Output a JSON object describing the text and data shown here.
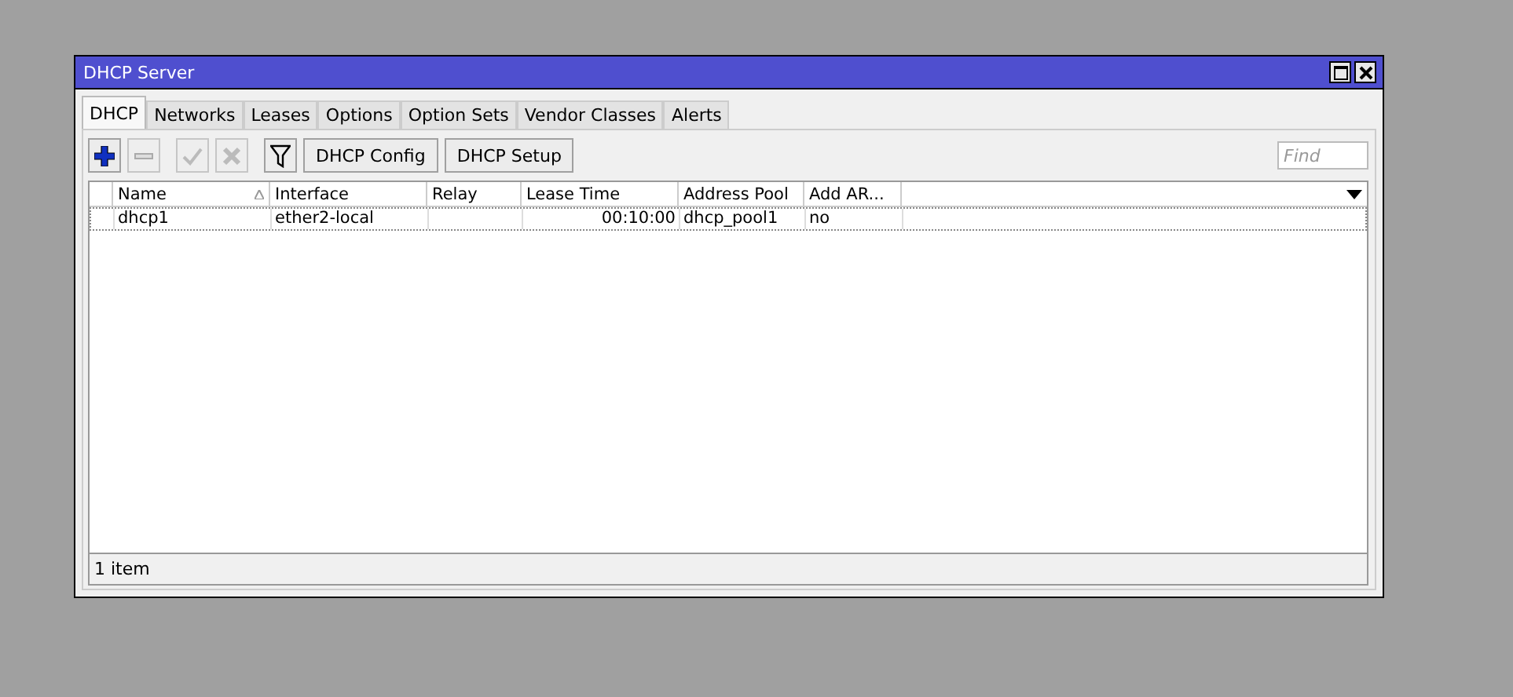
{
  "window": {
    "title": "DHCP Server"
  },
  "tabs": [
    {
      "label": "DHCP",
      "selected": true
    },
    {
      "label": "Networks",
      "selected": false
    },
    {
      "label": "Leases",
      "selected": false
    },
    {
      "label": "Options",
      "selected": false
    },
    {
      "label": "Option Sets",
      "selected": false
    },
    {
      "label": "Vendor Classes",
      "selected": false
    },
    {
      "label": "Alerts",
      "selected": false
    }
  ],
  "toolbar": [
    {
      "kind": "add",
      "disabled": false
    },
    {
      "kind": "remove",
      "disabled": true
    },
    {
      "kind": "enable",
      "disabled": true
    },
    {
      "kind": "disable",
      "disabled": true
    },
    {
      "kind": "filter",
      "disabled": false
    },
    {
      "kind": "text",
      "label": "DHCP Config",
      "disabled": false
    },
    {
      "kind": "text",
      "label": "DHCP Setup",
      "disabled": false
    }
  ],
  "search": {
    "placeholder": "Find"
  },
  "table": {
    "columns": [
      {
        "label": "Name",
        "sorted": true
      },
      {
        "label": "Interface",
        "sorted": false
      },
      {
        "label": "Relay",
        "sorted": false
      },
      {
        "label": "Lease Time",
        "sorted": false
      },
      {
        "label": "Address Pool",
        "sorted": false
      },
      {
        "label": "Add AR...",
        "sorted": false
      }
    ],
    "rows": [
      {
        "selected": false,
        "cells": [
          "dhcp1",
          "ether2-local",
          "",
          "00:10:00",
          "dhcp_pool1",
          "no"
        ]
      }
    ]
  },
  "status_bar": "1 item"
}
